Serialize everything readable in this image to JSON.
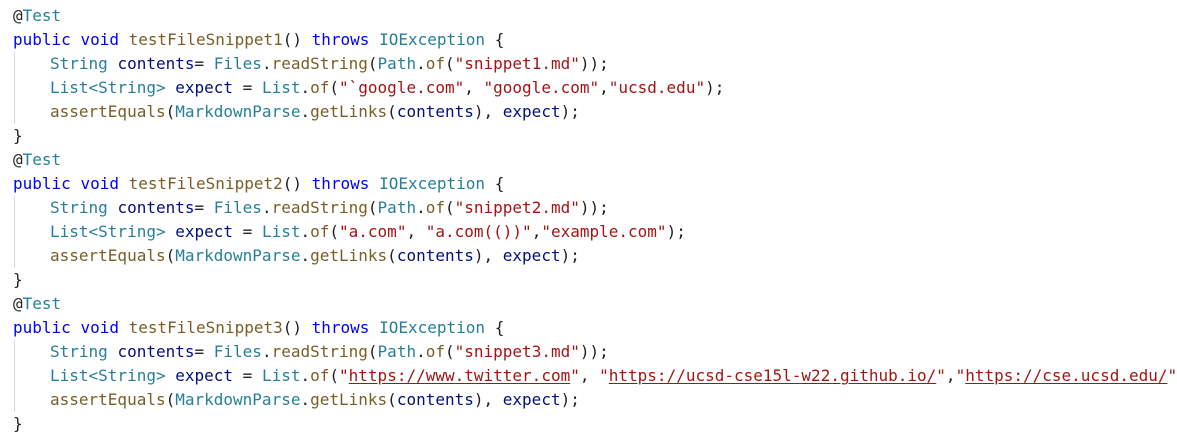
{
  "code": {
    "annotation_at": "@",
    "annotation_name": "Test",
    "kw_public": "public",
    "kw_void": "void",
    "kw_throws": "throws",
    "exception_type": "IOException",
    "open_brace": "{",
    "close_brace": "}",
    "type_string": "String",
    "var_contents": "contents",
    "files": "Files",
    "read_string": "readString",
    "path": "Path",
    "of": "of",
    "list": "List",
    "list_generic": "List<String>",
    "var_expect": "expect",
    "assert_equals": "assertEquals",
    "markdown_parse": "MarkdownParse",
    "get_links": "getLinks",
    "methods": [
      {
        "name": "testFileSnippet1",
        "file": "\"snippet1.md\"",
        "expected": [
          "\"`google.com\"",
          "\"google.com\"",
          "\"ucsd.edu\""
        ]
      },
      {
        "name": "testFileSnippet2",
        "file": "\"snippet2.md\"",
        "expected": [
          "\"a.com\"",
          "\"a.com(())\"",
          "\"example.com\""
        ]
      },
      {
        "name": "testFileSnippet3",
        "file": "\"snippet3.md\"",
        "expected_links": [
          {
            "q1": "\"",
            "url": "https://www.twitter.com",
            "q2": "\""
          },
          {
            "q1": "\"",
            "url": "https://ucsd-cse15l-w22.github.io/",
            "q2": "\""
          },
          {
            "q1": "\"",
            "url": "https://cse.ucsd.edu/",
            "q2": "\""
          }
        ]
      }
    ]
  }
}
